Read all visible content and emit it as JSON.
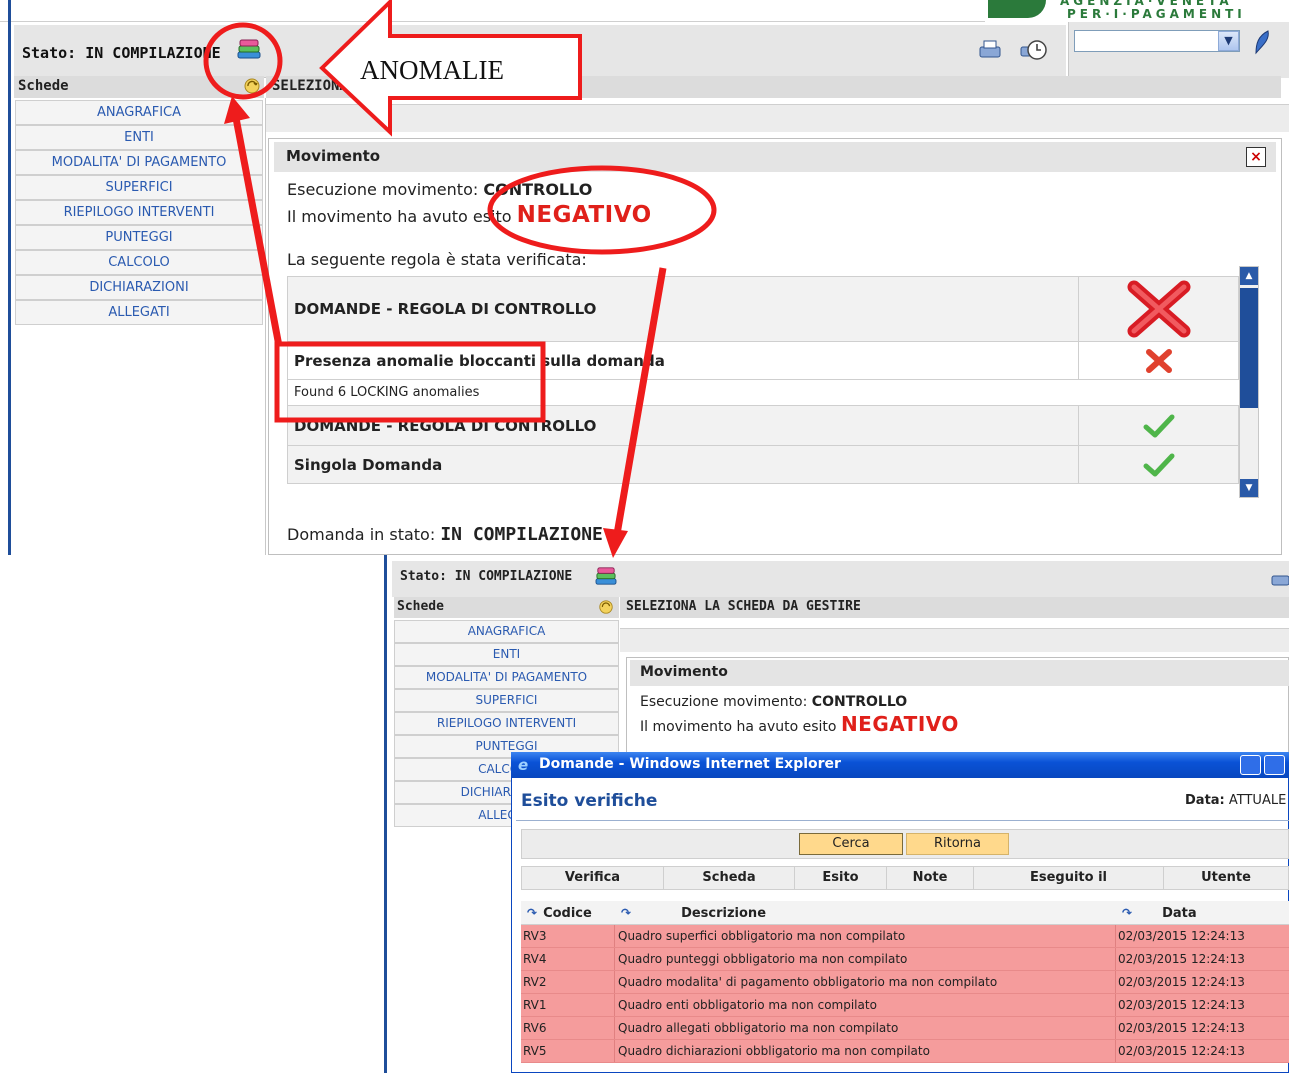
{
  "logo": {
    "line1": "AGENZIA·VENETA",
    "line2": "PER·I·PAGAMENTI"
  },
  "top": {
    "status_label": "Stato:",
    "status_value": "IN COMPILAZIONE",
    "schede_header": "Schede",
    "selezione_header": "SELEZIONA LA SCHEDA DA GESTIRE",
    "menu": [
      "ANAGRAFICA",
      "ENTI",
      "MODALITA' DI PAGAMENTO",
      "SUPERFICI",
      "RIEPILOGO INTERVENTI",
      "PUNTEGGI",
      "CALCOLO",
      "DICHIARAZIONI",
      "ALLEGATI"
    ],
    "movimento": {
      "title": "Movimento",
      "exec_label": "Esecuzione movimento:",
      "exec_value": "CONTROLLO",
      "esito_label": "Il movimento ha avuto esito",
      "esito_value": "NEGATIVO",
      "rule_intro": "La seguente regola è stata verificata:",
      "rules": [
        {
          "text": "DOMANDE - REGOLA DI CONTROLLO",
          "result": "fail-large"
        },
        {
          "text": "Presenza anomalie bloccanti sulla domanda",
          "result": "fail"
        },
        {
          "text": "Found 6 LOCKING anomalies",
          "result": "none"
        },
        {
          "text": "DOMANDE - REGOLA DI CONTROLLO",
          "result": "ok"
        },
        {
          "text": "Singola Domanda",
          "result": "ok"
        }
      ],
      "domanda_label": "Domanda in stato:",
      "domanda_value": "IN COMPILAZIONE"
    }
  },
  "annotation": {
    "label": "ANOMALIE"
  },
  "bottom": {
    "status_label": "Stato:",
    "status_value": "IN COMPILAZIONE",
    "schede_header": "Schede",
    "selezione_header": "SELEZIONA LA SCHEDA DA GESTIRE",
    "menu": [
      "ANAGRAFICA",
      "ENTI",
      "MODALITA' DI PAGAMENTO",
      "SUPERFICI",
      "RIEPILOGO INTERVENTI",
      "PUNTEGGI",
      "CALCOLO",
      "DICHIARAZIONI",
      "ALLEGATI"
    ],
    "movimento": {
      "title": "Movimento",
      "exec_label": "Esecuzione movimento:",
      "exec_value": "CONTROLLO",
      "esito_label": "Il movimento ha avuto esito",
      "esito_value": "NEGATIVO"
    }
  },
  "popup": {
    "window_title": "Domande - Windows Internet Explorer",
    "heading": "Esito verifiche",
    "data_label": "Data:",
    "data_value": "ATTUALE",
    "buttons": {
      "cerca": "Cerca",
      "ritorna": "Ritorna"
    },
    "verifica_columns": [
      "Verifica",
      "Scheda",
      "Esito",
      "Note",
      "Eseguito il",
      "Utente"
    ],
    "anomalie_columns": {
      "codice": "Codice",
      "descrizione": "Descrizione",
      "data": "Data"
    },
    "anomalie": [
      {
        "codice": "RV3",
        "descrizione": "Quadro superfici obbligatorio ma non compilato",
        "data": "02/03/2015 12:24:13"
      },
      {
        "codice": "RV4",
        "descrizione": "Quadro punteggi obbligatorio ma non compilato",
        "data": "02/03/2015 12:24:13"
      },
      {
        "codice": "RV2",
        "descrizione": "Quadro modalita' di pagamento obbligatorio ma non compilato",
        "data": "02/03/2015 12:24:13"
      },
      {
        "codice": "RV1",
        "descrizione": "Quadro enti obbligatorio ma non compilato",
        "data": "02/03/2015 12:24:13"
      },
      {
        "codice": "RV6",
        "descrizione": "Quadro allegati obbligatorio ma non compilato",
        "data": "02/03/2015 12:24:13"
      },
      {
        "codice": "RV5",
        "descrizione": "Quadro dichiarazioni obbligatorio ma non compilato",
        "data": "02/03/2015 12:24:13"
      }
    ]
  },
  "colors": {
    "accent_blue": "#1f4e9a",
    "negative_red": "#e0201a",
    "annotation_red": "#ee1c1c",
    "row_error": "#f59c9c",
    "button_yellow": "#ffd98c"
  }
}
